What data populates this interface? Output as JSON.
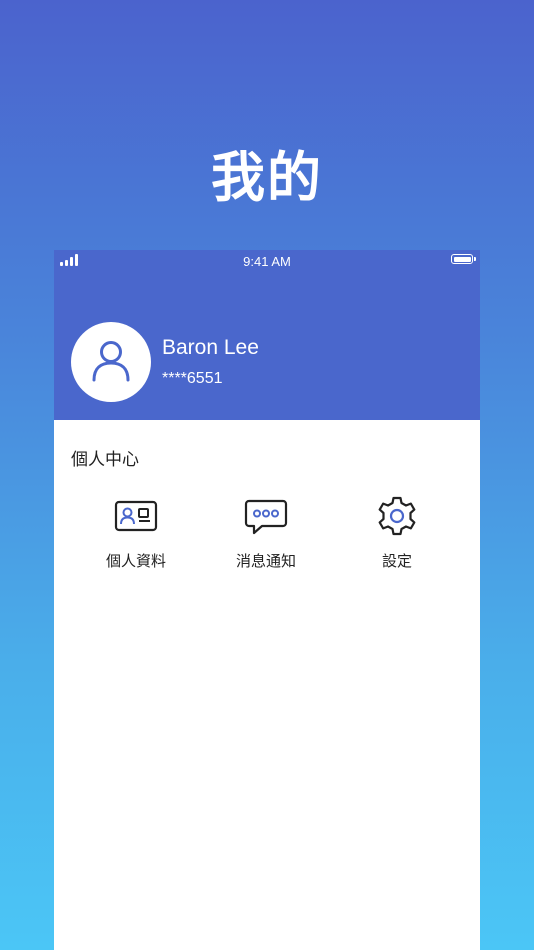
{
  "hero": {
    "title": "我的"
  },
  "status_bar": {
    "time": "9:41 AM"
  },
  "profile": {
    "name": "Baron Lee",
    "phone_masked": "****6551"
  },
  "section": {
    "title": "個人中心"
  },
  "menu": [
    {
      "label": "個人資料",
      "icon": "id-card-icon"
    },
    {
      "label": "消息通知",
      "icon": "chat-bubble-icon"
    },
    {
      "label": "設定",
      "icon": "gear-icon"
    }
  ],
  "colors": {
    "header_blue": "#4a67cc",
    "icon_stroke": "#222222",
    "icon_accent": "#4a67cc",
    "gradient_top": "#4b63cd",
    "gradient_bottom": "#4bc6f6"
  }
}
